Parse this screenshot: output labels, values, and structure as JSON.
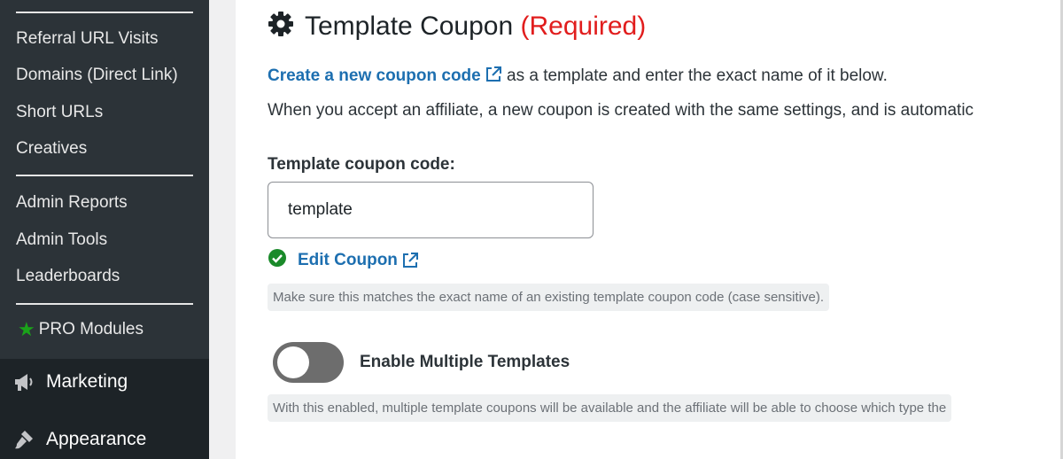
{
  "sidebar": {
    "items": [
      {
        "label": "Referral URL Visits"
      },
      {
        "label": "Domains (Direct Link)"
      },
      {
        "label": "Short URLs"
      },
      {
        "label": "Creatives"
      },
      {
        "label": "Admin Reports"
      },
      {
        "label": "Admin Tools"
      },
      {
        "label": "Leaderboards"
      }
    ],
    "pro_modules_label": "PRO Modules",
    "menus": [
      {
        "label": "Marketing",
        "icon": "megaphone-icon"
      },
      {
        "label": "Appearance",
        "icon": "paintbrush-icon"
      }
    ]
  },
  "section": {
    "title": "Template Coupon",
    "required_label": "(Required)",
    "create_link_label": "Create a new coupon code",
    "create_link_suffix": " as a template and enter the exact name of it below.",
    "description": "When you accept an affiliate, a new coupon is created with the same settings, and is automatic",
    "field_label": "Template coupon code:",
    "field_value": "template",
    "edit_link_label": "Edit Coupon",
    "hint_match": "Make sure this matches the exact name of an existing template coupon code (case sensitive).",
    "toggle_label": "Enable Multiple Templates",
    "toggle_state": "off",
    "hint_toggle": "With this enabled, multiple template coupons will be available and the affiliate will be able to choose which type the"
  },
  "colors": {
    "sidebar_bg": "#2c3338",
    "sidebar_menu_bg": "#1d2327",
    "link": "#1d6fb0",
    "required": "#e11d1d",
    "success": "#1a8a2a",
    "star": "#1aa31a"
  }
}
